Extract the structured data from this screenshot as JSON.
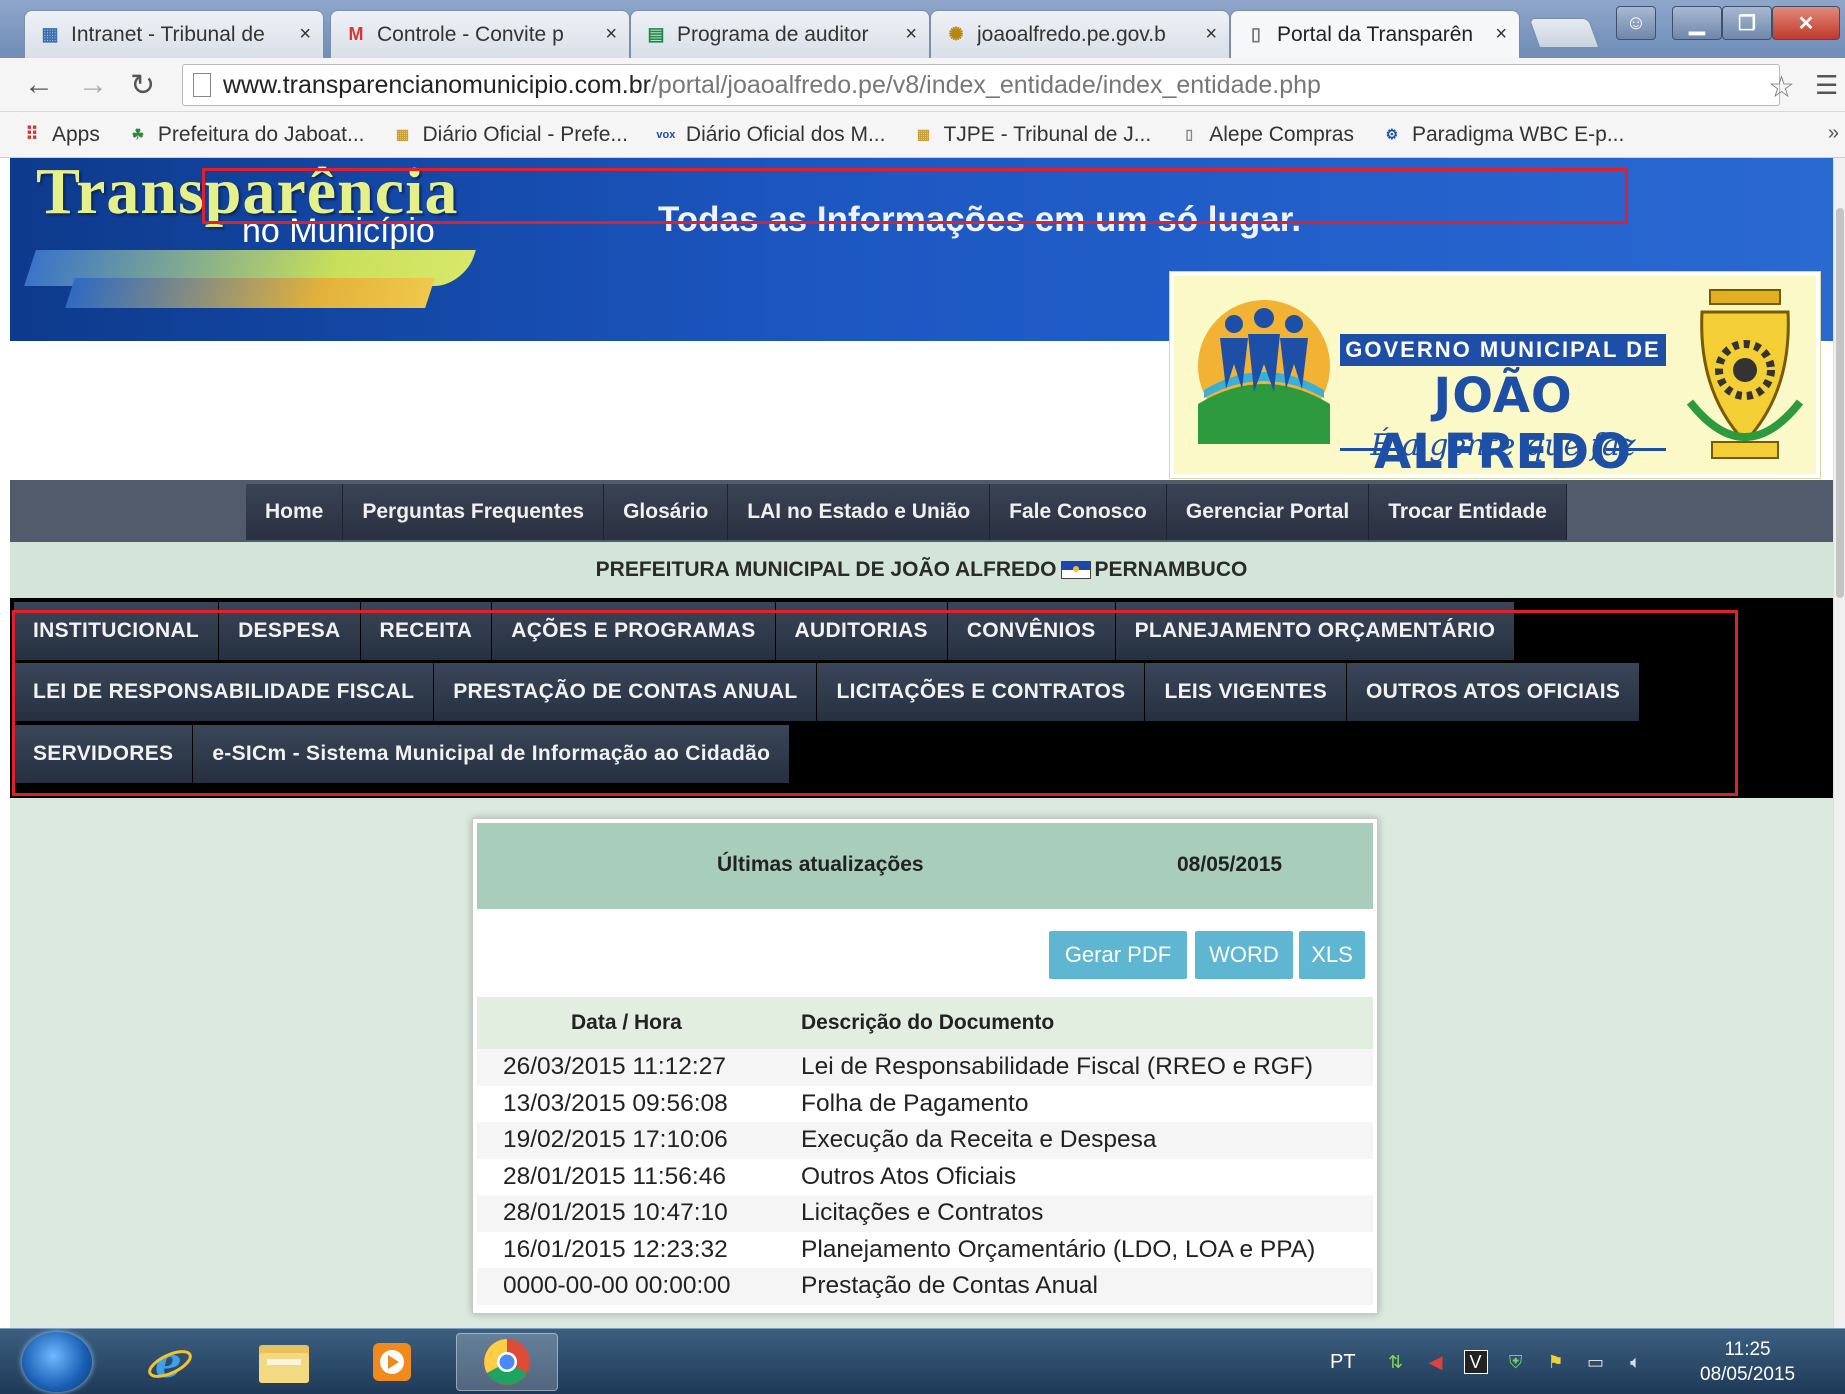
{
  "browser": {
    "tabs": [
      {
        "label": "Intranet - Tribunal de",
        "icon": "building-icon",
        "close": "×"
      },
      {
        "label": "Controle - Convite p",
        "icon": "gmail-icon",
        "close": "×"
      },
      {
        "label": "Programa de auditor",
        "icon": "sheets-icon",
        "close": "×"
      },
      {
        "label": "joaoalfredo.pe.gov.b",
        "icon": "seal-icon",
        "close": "×"
      },
      {
        "label": "Portal da Transparên",
        "icon": "page-icon",
        "close": "×"
      }
    ],
    "url_domain": "www.transparencianomunicipio.com.br",
    "url_path": "/portal/joaoalfredo.pe/v8/index_entidade/index_entidade.php",
    "bookmarks": [
      {
        "label": "Apps",
        "icon": "apps-grid-icon"
      },
      {
        "label": "Prefeitura do Jaboat...",
        "icon": "people-icon"
      },
      {
        "label": "Diário Oficial - Prefe...",
        "icon": "building-icon"
      },
      {
        "label": "Diário Oficial dos M...",
        "icon": "vox-icon"
      },
      {
        "label": "TJPE - Tribunal de J...",
        "icon": "building-icon"
      },
      {
        "label": "Alepe Compras",
        "icon": "page-icon"
      },
      {
        "label": "Paradigma WBC E-p...",
        "icon": "gear-person-icon"
      }
    ],
    "bookmarks_more": "»"
  },
  "header": {
    "logo_title": "Transparência",
    "logo_subtitle": "no Município",
    "tagline": "Todas as Informações em um só lugar.",
    "gov_line1": "GOVERNO MUNICIPAL DE",
    "gov_line2": "JOÃO ALFREDO",
    "gov_line3": "É a gente que faz"
  },
  "top_nav": [
    "Home",
    "Perguntas Frequentes",
    "Glosário",
    "LAI no Estado e União",
    "Fale Conosco",
    "Gerenciar Portal",
    "Trocar Entidade"
  ],
  "entity": {
    "name": "PREFEITURA MUNICIPAL DE JOÃO ALFREDO",
    "state": "PERNAMBUCO"
  },
  "main_nav": {
    "row1": [
      "INSTITUCIONAL",
      "DESPESA",
      "RECEITA",
      "AÇÕES E PROGRAMAS",
      "AUDITORIAS",
      "CONVÊNIOS",
      "PLANEJAMENTO ORÇAMENTÁRIO"
    ],
    "row2": [
      "LEI DE RESPONSABILIDADE FISCAL",
      "PRESTAÇÃO DE CONTAS ANUAL",
      "LICITAÇÕES E CONTRATOS",
      "LEIS VIGENTES",
      "OUTROS ATOS OFICIAIS"
    ],
    "row3": [
      "SERVIDORES",
      "e-SICm - Sistema Municipal de Informação ao Cidadão"
    ]
  },
  "updates": {
    "title": "Últimas atualizações",
    "date": "08/05/2015",
    "buttons": {
      "pdf": "Gerar PDF",
      "word": "WORD",
      "xls": "XLS"
    },
    "col_date": "Data / Hora",
    "col_desc": "Descrição do Documento",
    "rows": [
      {
        "date": "26/03/2015 11:12:27",
        "desc": "Lei de Responsabilidade Fiscal (RREO e RGF)"
      },
      {
        "date": "13/03/2015 09:56:08",
        "desc": "Folha de Pagamento"
      },
      {
        "date": "19/02/2015 17:10:06",
        "desc": "Execução da Receita e Despesa"
      },
      {
        "date": "28/01/2015 11:56:46",
        "desc": "Outros Atos Oficiais"
      },
      {
        "date": "28/01/2015 10:47:10",
        "desc": "Licitações e Contratos"
      },
      {
        "date": "16/01/2015 12:23:32",
        "desc": "Planejamento Orçamentário (LDO, LOA e PPA)"
      },
      {
        "date": "0000-00-00 00:00:00",
        "desc": "Prestação de Contas Anual"
      }
    ]
  },
  "taskbar": {
    "language": "PT",
    "time": "11:25",
    "date": "08/05/2015",
    "apps": [
      "internet-explorer-icon",
      "file-explorer-icon",
      "media-player-icon",
      "chrome-icon"
    ]
  },
  "colors": {
    "highlight": "#e0202a",
    "banner": "#1c57c2",
    "export_button": "#5fb6d0",
    "panel_header": "#a9cdbb"
  }
}
